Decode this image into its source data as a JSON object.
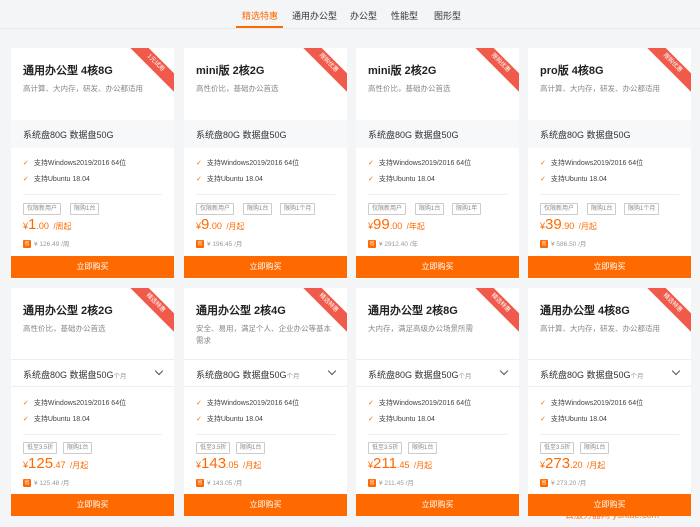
{
  "tabs": [
    {
      "label": "精选特惠",
      "active": true
    },
    {
      "label": "通用办公型",
      "active": false
    },
    {
      "label": "办公型",
      "active": false
    },
    {
      "label": "性能型",
      "active": false
    },
    {
      "label": "图形型",
      "active": false
    }
  ],
  "common": {
    "buy_label": "立即购买",
    "feature_windows": "支持Windows2019/2016 64位",
    "feature_ubuntu": "支持Ubuntu 18.04",
    "storage": "系统盘80G 数据盘50G",
    "storage_suffix": "个月",
    "check_icon": "✓"
  },
  "row1": [
    {
      "title": "通用办公型 4核8G",
      "ribbon": "1元试用",
      "desc": "高计算、大内存，研发、办公都适用",
      "tags": [
        "仅限新用户",
        "限购1台"
      ],
      "price_int": "1",
      "price_dec": ".00",
      "price_unit": "/周起",
      "orig": "¥ 126.49 /周"
    },
    {
      "title": "mini版 2核2G",
      "ribbon": "限购优惠",
      "desc": "高性价比，基础办公首选",
      "tags": [
        "仅限新用户",
        "限购1台",
        "限购1个月"
      ],
      "price_int": "9",
      "price_dec": ".00",
      "price_unit": "/月起",
      "orig": "¥ 196.45 /月"
    },
    {
      "title": "mini版 2核2G",
      "ribbon": "限购优惠",
      "desc": "高性价比，基础办公首选",
      "tags": [
        "仅限新用户",
        "限购1台",
        "限购1年"
      ],
      "price_int": "99",
      "price_dec": ".00",
      "price_unit": "/年起",
      "orig": "¥ 2912.40 /年"
    },
    {
      "title": "pro版 4核8G",
      "ribbon": "限购优惠",
      "desc": "高计算、大内存，研发、办公都适用",
      "tags": [
        "仅限新用户",
        "限购1台",
        "限购1个月"
      ],
      "price_int": "39",
      "price_dec": ".90",
      "price_unit": "/月起",
      "orig": "¥ 586.50 /月"
    }
  ],
  "row2": [
    {
      "title": "通用办公型 2核2G",
      "ribbon": "精选特惠",
      "desc": "高性价比，基础办公首选",
      "tags": [
        "低至3.5折",
        "限购1台"
      ],
      "price_int": "125",
      "price_dec": ".47",
      "price_unit": "/月起",
      "orig": "¥ 125.48 /月"
    },
    {
      "title": "通用办公型 2核4G",
      "ribbon": "精选特惠",
      "desc": "安全、易用，满足个人、企业办公等基本需求",
      "tags": [
        "低至3.5折",
        "限购1台"
      ],
      "price_int": "143",
      "price_dec": ".05",
      "price_unit": "/月起",
      "orig": "¥ 143.05 /月"
    },
    {
      "title": "通用办公型 2核8G",
      "ribbon": "精选特惠",
      "desc": "大内存，满足高级办公场景所需",
      "tags": [
        "低至3.5折",
        "限购1台"
      ],
      "price_int": "211",
      "price_dec": ".45",
      "price_unit": "/月起",
      "orig": "¥ 211.45 /月"
    },
    {
      "title": "通用办公型 4核8G",
      "ribbon": "精选特惠",
      "desc": "高计算、大内存，研发、办公都适用",
      "tags": [
        "低至3.5折",
        "限购1台"
      ],
      "price_int": "273",
      "price_dec": ".20",
      "price_unit": "/月起",
      "orig": "¥ 273.20 /月"
    }
  ],
  "currency": "¥",
  "orig_icon": "省",
  "watermark": "云服务器网 yuntue.com",
  "colors": {
    "accent": "#ff6a00",
    "ribbon": "#f05a4a"
  }
}
